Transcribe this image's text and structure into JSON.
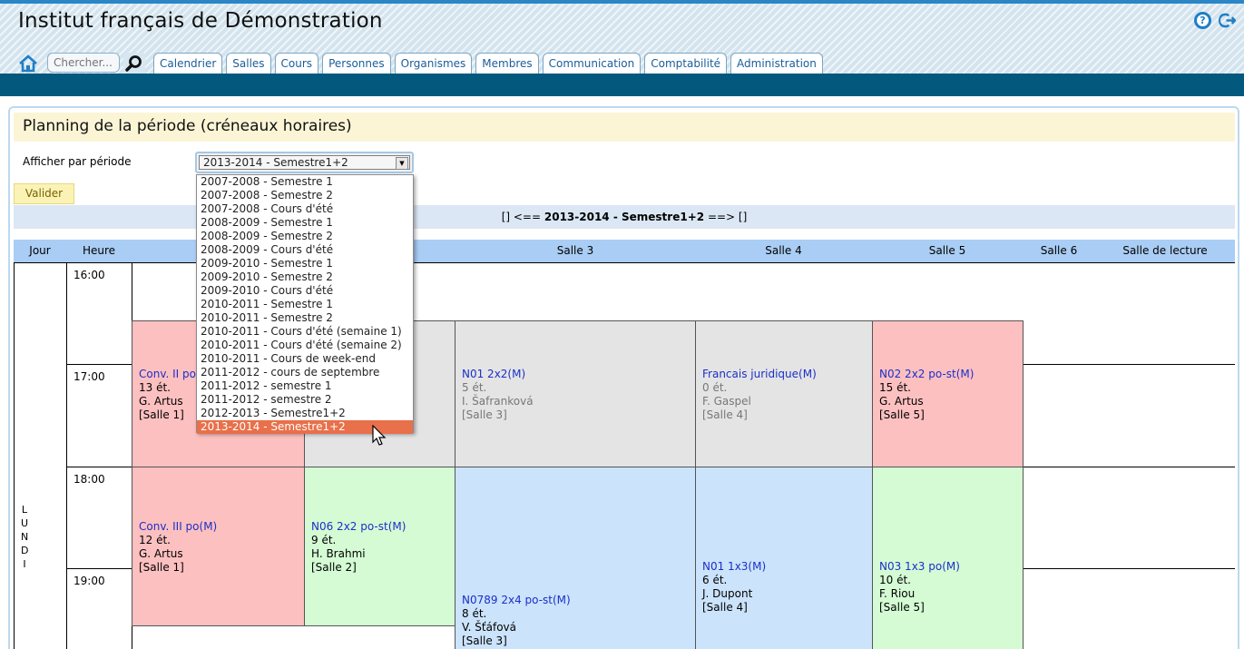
{
  "header": {
    "title": "Institut français de Démonstration",
    "search_placeholder": "Chercher...",
    "help_glyph": "?",
    "tabs": [
      "Calendrier",
      "Salles",
      "Cours",
      "Personnes",
      "Organismes",
      "Membres",
      "Communication",
      "Comptabilité",
      "Administration"
    ]
  },
  "panel": {
    "title": "Planning de la période (créneaux horaires)",
    "period_label": "Afficher par période",
    "selected_period": "2013-2014 - Semestre1+2",
    "validate_label": "Valider",
    "nav": {
      "prev": "[] <==",
      "current": "2013-2014 - Semestre1+2",
      "next": "==> []"
    }
  },
  "dropdown_options": [
    "2007-2008 - Semestre 1",
    "2007-2008 - Semestre 2",
    "2007-2008 - Cours d'été",
    "2008-2009 - Semestre 1",
    "2008-2009 - Semestre 2",
    "2008-2009 - Cours d'été",
    "2009-2010 - Semestre 1",
    "2009-2010 - Semestre 2",
    "2009-2010 - Cours d'été",
    "2010-2011 - Semestre 1",
    "2010-2011 - Semestre 2",
    "2010-2011 - Cours d'été (semaine 1)",
    "2010-2011 - Cours d'été (semaine 2)",
    "2010-2011 - Cours de week-end",
    "2011-2012 - cours de septembre",
    "2011-2012 - semestre 1",
    "2011-2012 - semestre 2",
    "2012-2013 - Semestre1+2",
    "2013-2014 - Semestre1+2"
  ],
  "grid": {
    "columns": [
      "Jour",
      "Heure",
      "Salle 3",
      "Salle 4",
      "Salle 5",
      "Salle 6",
      "Salle de lecture"
    ],
    "day": "LUNDI",
    "hours": [
      "16:00",
      "17:00",
      "18:00",
      "19:00"
    ],
    "courses": [
      {
        "title": "Conv. II po",
        "students": "13 ét.",
        "teacher": "G. Artus",
        "room": "[Salle 1]"
      },
      {
        "title": "N01 2x2(M)",
        "students": "5 ét.",
        "teacher": "I. Šafranková",
        "room": "[Salle 3]"
      },
      {
        "title": "Francais juridique(M)",
        "students": "0 ét.",
        "teacher": "F. Gaspel",
        "room": "[Salle 4]"
      },
      {
        "title": "N02 2x2 po-st(M)",
        "students": "15 ét.",
        "teacher": "G. Artus",
        "room": "[Salle 5]"
      },
      {
        "title": "Conv. III po(M)",
        "students": "12 ét.",
        "teacher": "G. Artus",
        "room": "[Salle 1]"
      },
      {
        "title": "N06 2x2 po-st(M)",
        "students": "9 ét.",
        "teacher": "H. Brahmi",
        "room": "[Salle 2]"
      },
      {
        "title": "N0789 2x4 po-st(M)",
        "students": "8 ét.",
        "teacher": "V. Šťáfová",
        "room": "[Salle 3]"
      },
      {
        "title": "N01 1x3(M)",
        "students": "6 ét.",
        "teacher": "J. Dupont",
        "room": "[Salle 4]"
      },
      {
        "title": "N03 1x3 po(M)",
        "students": "10 ét.",
        "teacher": "F. Riou",
        "room": "[Salle 5]"
      }
    ]
  },
  "colors": {
    "nav_bar": "#03587e",
    "accent": "#2a86c6",
    "cell_red": "#fdc0c0",
    "cell_green": "#d4fbd4",
    "cell_blue": "#cbe3fb",
    "cell_gray": "#e4e4e4",
    "selected_option": "#e8704a"
  },
  "icons": [
    "home-icon",
    "search-icon",
    "help-icon",
    "logout-icon",
    "mouse-pointer-icon"
  ]
}
